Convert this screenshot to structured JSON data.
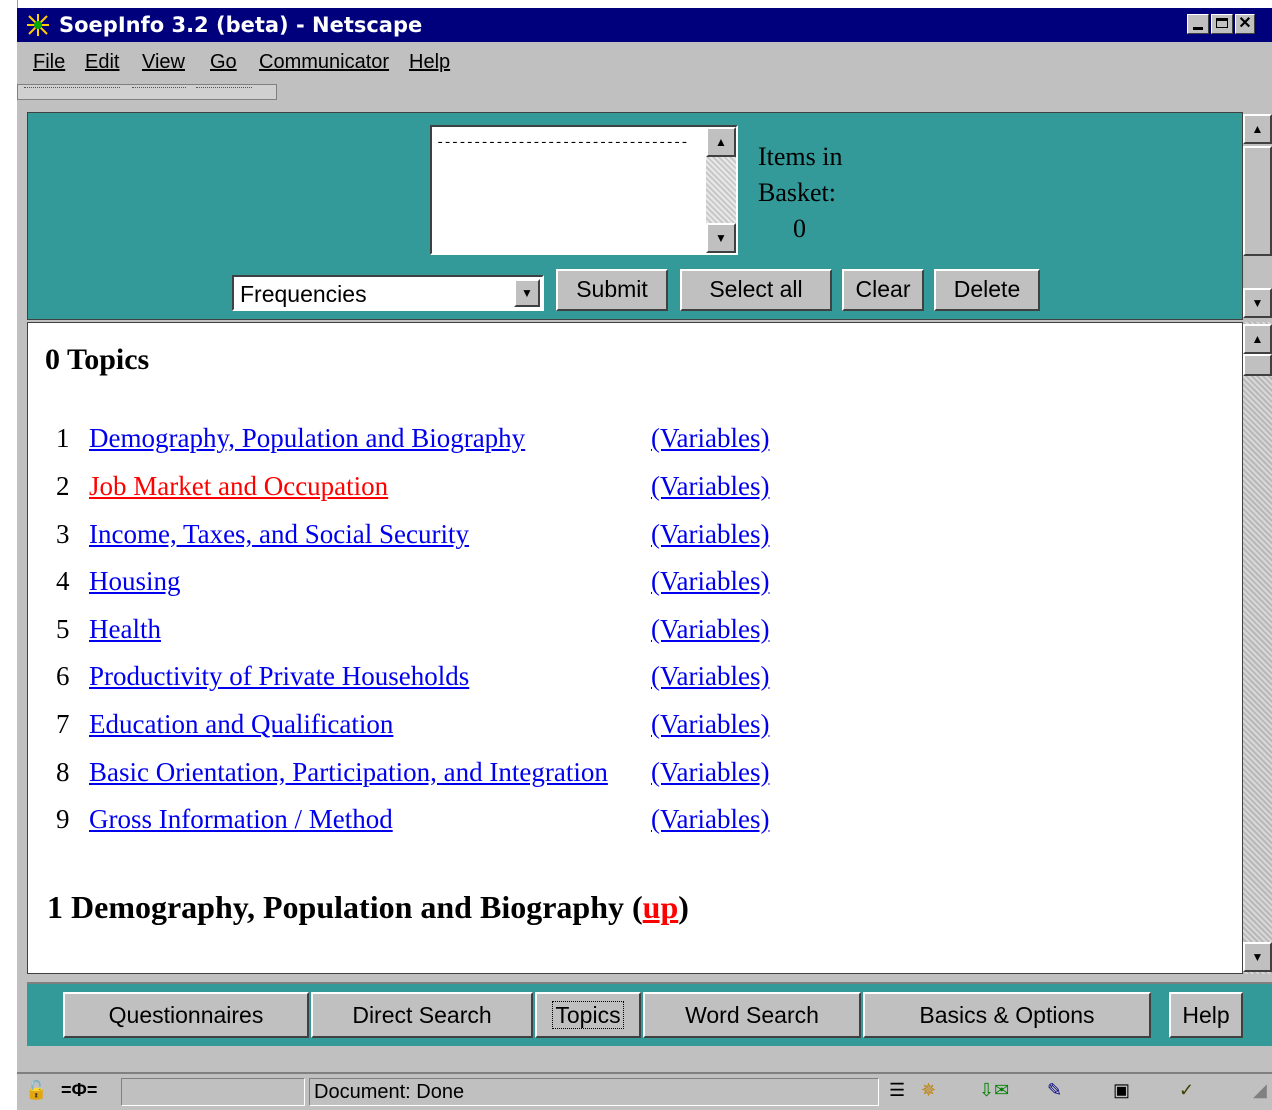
{
  "window": {
    "title": "SoepInfo 3.2 (beta) - Netscape",
    "controls": [
      "minimize",
      "maximize",
      "close"
    ]
  },
  "menu": [
    "File",
    "Edit",
    "View",
    "Go",
    "Communicator",
    "Help"
  ],
  "basket": {
    "list_item": "----------------------------------",
    "label_line1": "Items in",
    "label_line2": "Basket:",
    "count": "0"
  },
  "toolbar": {
    "select_value": "Frequencies",
    "submit": "Submit",
    "select_all": "Select all",
    "clear": "Clear",
    "delete": "Delete"
  },
  "content": {
    "heading": "0 Topics",
    "topics": [
      {
        "num": "1",
        "label": "Demography, Population and Biography",
        "vars": "(Variables)",
        "visited": false
      },
      {
        "num": "2",
        "label": "Job Market and Occupation",
        "vars": "(Variables)",
        "visited": true
      },
      {
        "num": "3",
        "label": "Income, Taxes, and Social Security",
        "vars": "(Variables)",
        "visited": false
      },
      {
        "num": "4",
        "label": "Housing",
        "vars": "(Variables)",
        "visited": false
      },
      {
        "num": "5",
        "label": "Health",
        "vars": "(Variables)",
        "visited": false
      },
      {
        "num": "6",
        "label": "Productivity of Private Households",
        "vars": "(Variables)",
        "visited": false
      },
      {
        "num": "7",
        "label": "Education and Qualification",
        "vars": "(Variables)",
        "visited": false
      },
      {
        "num": "8",
        "label": "Basic Orientation, Participation, and Integration",
        "vars": "(Variables)",
        "visited": false
      },
      {
        "num": "9",
        "label": "Gross Information / Method",
        "vars": "(Variables)",
        "visited": false
      }
    ],
    "section_heading": "1 Demography, Population and Biography",
    "up_link": "up"
  },
  "nav": {
    "questionnaires": "Questionnaires",
    "direct_search": "Direct Search",
    "topics": "Topics",
    "word_search": "Word Search",
    "basics_options": "Basics & Options",
    "help": "Help"
  },
  "status": {
    "text": "Document: Done"
  },
  "colors": {
    "titlebar": "#00007c",
    "frame_teal": "#339999",
    "link": "#0000ee",
    "visited_link": "#ff0000"
  }
}
